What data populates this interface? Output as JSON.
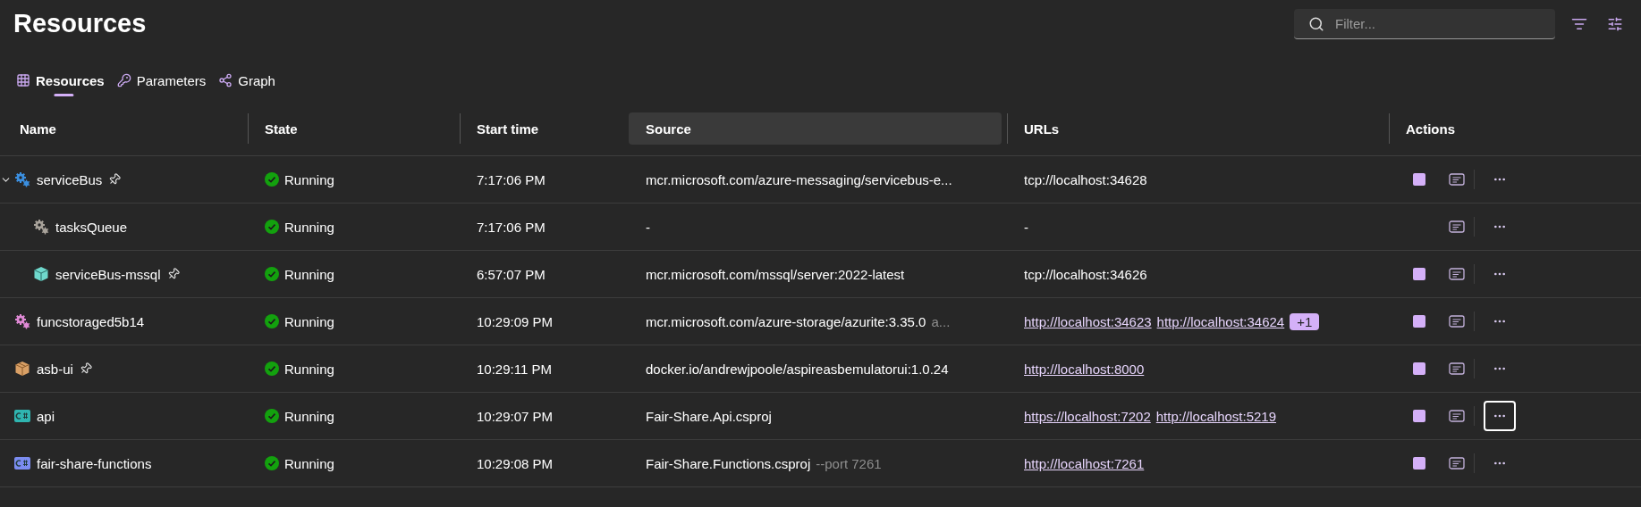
{
  "title": "Resources",
  "filter": {
    "placeholder": "Filter..."
  },
  "tabs": [
    {
      "label": "Resources",
      "selected": true
    },
    {
      "label": "Parameters",
      "selected": false
    },
    {
      "label": "Graph",
      "selected": false
    }
  ],
  "table": {
    "columns": [
      {
        "label": "Name",
        "highlighted": false
      },
      {
        "label": "State",
        "highlighted": false
      },
      {
        "label": "Start time",
        "highlighted": false
      },
      {
        "label": "Source",
        "highlighted": true
      },
      {
        "label": "URLs",
        "highlighted": false
      },
      {
        "label": "Actions",
        "highlighted": false
      }
    ],
    "rows": [
      {
        "name": "serviceBus",
        "kind": "gears",
        "color": "#3b8fe0",
        "pinned": true,
        "expanded": true,
        "state": {
          "kind": "running",
          "label": "Running"
        },
        "start_time": "7:17:06 PM",
        "source": {
          "text": "mcr.microsoft.com/azure-messaging/servicebus-e..."
        },
        "urls": [
          {
            "text": "tcp://localhost:34628",
            "link": false
          }
        ],
        "actions": {
          "stop": true,
          "focused": false
        },
        "children": [
          {
            "name": "tasksQueue",
            "kind": "gears",
            "color": "#a8a29a",
            "pinned": false,
            "state": {
              "kind": "running",
              "label": "Running"
            },
            "start_time": "7:17:06 PM",
            "source": {
              "text": "-"
            },
            "urls": [
              {
                "text": "-",
                "link": false
              }
            ],
            "actions": {
              "stop": false,
              "focused": false
            }
          },
          {
            "name": "serviceBus-mssql",
            "kind": "cube",
            "color": "#6fd8cc",
            "pinned": true,
            "state": {
              "kind": "running",
              "label": "Running"
            },
            "start_time": "6:57:07 PM",
            "source": {
              "text": "mcr.microsoft.com/mssql/server:2022-latest"
            },
            "urls": [
              {
                "text": "tcp://localhost:34626",
                "link": false
              }
            ],
            "actions": {
              "stop": true,
              "focused": false
            }
          }
        ]
      },
      {
        "name": "funcstoraged5b14",
        "kind": "gears",
        "color": "#e08ad6",
        "pinned": false,
        "state": {
          "kind": "running",
          "label": "Running"
        },
        "start_time": "10:29:09 PM",
        "source": {
          "text": "mcr.microsoft.com/azure-storage/azurite:3.35.0",
          "extra": "a..."
        },
        "urls": [
          {
            "text": "http://localhost:34623",
            "link": true
          },
          {
            "text": "http://localhost:34624",
            "link": true
          }
        ],
        "more_urls": "+1",
        "actions": {
          "stop": true,
          "focused": false
        }
      },
      {
        "name": "asb-ui",
        "kind": "package",
        "color": "#d9a066",
        "pinned": true,
        "state": {
          "kind": "running",
          "label": "Running"
        },
        "start_time": "10:29:11 PM",
        "source": {
          "text": "docker.io/andrewjpoole/aspireasbemulatorui:1.0.24"
        },
        "urls": [
          {
            "text": "http://localhost:8000",
            "link": true
          }
        ],
        "actions": {
          "stop": true,
          "focused": false
        }
      },
      {
        "name": "api",
        "kind": "csharp",
        "color": "#2fb5b0",
        "pinned": false,
        "state": {
          "kind": "running",
          "label": "Running"
        },
        "start_time": "10:29:07 PM",
        "source": {
          "text": "Fair-Share.Api.csproj"
        },
        "urls": [
          {
            "text": "https://localhost:7202",
            "link": true
          },
          {
            "text": "http://localhost:5219",
            "link": true
          }
        ],
        "actions": {
          "stop": true,
          "focused": true
        }
      },
      {
        "name": "fair-share-functions",
        "kind": "csharp",
        "color": "#7b8cf0",
        "pinned": false,
        "state": {
          "kind": "running",
          "label": "Running"
        },
        "start_time": "10:29:08 PM",
        "source": {
          "text": "Fair-Share.Functions.csproj",
          "extra": "--port 7261"
        },
        "urls": [
          {
            "text": "http://localhost:7261",
            "link": true
          }
        ],
        "actions": {
          "stop": true,
          "focused": false
        }
      }
    ]
  }
}
